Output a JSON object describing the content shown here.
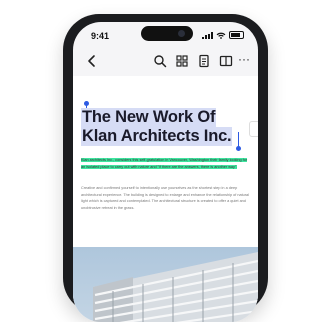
{
  "status": {
    "time": "9:41"
  },
  "toolbar": {
    "icons": [
      "back-chevron-icon",
      "search-icon",
      "grid-icon",
      "document-icon",
      "book-icon",
      "more-icon"
    ],
    "more_label": "···"
  },
  "document": {
    "title_line1": "The New Work Of",
    "title_line2": "Klan Architects Inc.",
    "highlighted_text": "Klan architects Inc., considers this self-gratulation in Vancouver, Washington their family looking for an isolated place to carry out with nature and \"if there are the answers, there is another way\".",
    "body_text": "Creative and confirmed yourself to intentionally use yourselves as the shortest step in a deep architectural experience. The building is designed to enlarge and enhance the relationship of natural light which is captured and contemplated. The architectural structure is created to offer a quiet and unobtrusive retreat in the grass."
  },
  "colors": {
    "title_highlight": "#d6dcf5",
    "text_highlight": "#3ee6a0",
    "selection_handle": "#2d5be3",
    "phone_frame": "#1b1c1f"
  }
}
